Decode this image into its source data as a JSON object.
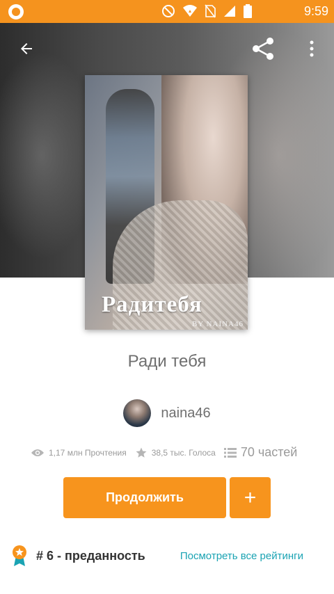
{
  "status_bar": {
    "time": "9:59",
    "icons": [
      "app-logo-icon",
      "do-not-disturb-icon",
      "wifi-icon",
      "no-sim-icon",
      "signal-icon",
      "battery-icon"
    ]
  },
  "toolbar": {
    "back_icon": "back-arrow-icon",
    "share_icon": "share-icon",
    "more_icon": "more-vertical-icon"
  },
  "cover": {
    "title": "Радитебя",
    "author_line": "BY NAINA46"
  },
  "story": {
    "title": "Ради тебя",
    "author": "naina46"
  },
  "stats": {
    "reads": "1,17 млн Прочтения",
    "votes": "38,5 тыс. Голоса",
    "parts": "70 частей"
  },
  "actions": {
    "continue_label": "Продолжить",
    "add_label": "+"
  },
  "ranking": {
    "text": "# 6 - преданность",
    "link": "Посмотреть все рейтинги"
  },
  "colors": {
    "accent": "#f7941d",
    "link": "#1aa3b3"
  }
}
